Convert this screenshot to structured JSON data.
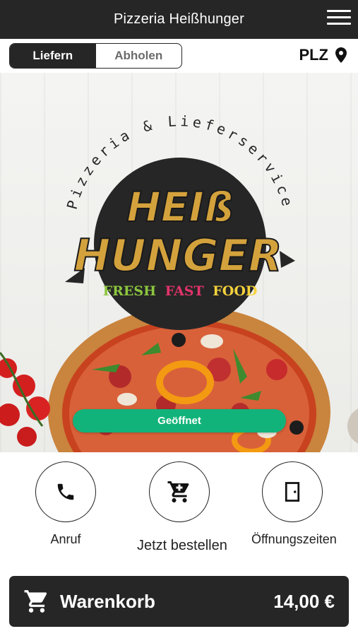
{
  "header": {
    "title": "Pizzeria Heißhunger",
    "menu_icon": "hamburger-menu-icon"
  },
  "mode_toggle": {
    "options": [
      "Liefern",
      "Abholen"
    ],
    "selected": "Liefern"
  },
  "postcode": {
    "label": "PLZ",
    "icon": "location-pin-icon"
  },
  "hero": {
    "logo": {
      "arc_text": "Pizzeria & Lieferservice",
      "line1": "HEIß",
      "line2": "HUNGER",
      "tagline": [
        "FRESH",
        "FAST",
        "FOOD"
      ]
    },
    "status": "Geöffnet"
  },
  "actions": [
    {
      "label": "Anruf",
      "icon": "phone-icon"
    },
    {
      "label": "Jetzt bestellen",
      "icon": "shopping-cart-icon"
    },
    {
      "label": "Öffnungszeiten",
      "icon": "door-icon"
    }
  ],
  "cart": {
    "label": "Warenkorb",
    "total": "14,00 €",
    "icon": "shopping-cart-icon"
  },
  "colors": {
    "bar": "#262626",
    "status_green": "#12b37a",
    "logo_gold": "#d4a23c",
    "logo_dark": "#262626",
    "tagline_green": "#8cc63f",
    "tagline_red": "#e2336b",
    "tagline_yellow": "#f5d23c"
  }
}
